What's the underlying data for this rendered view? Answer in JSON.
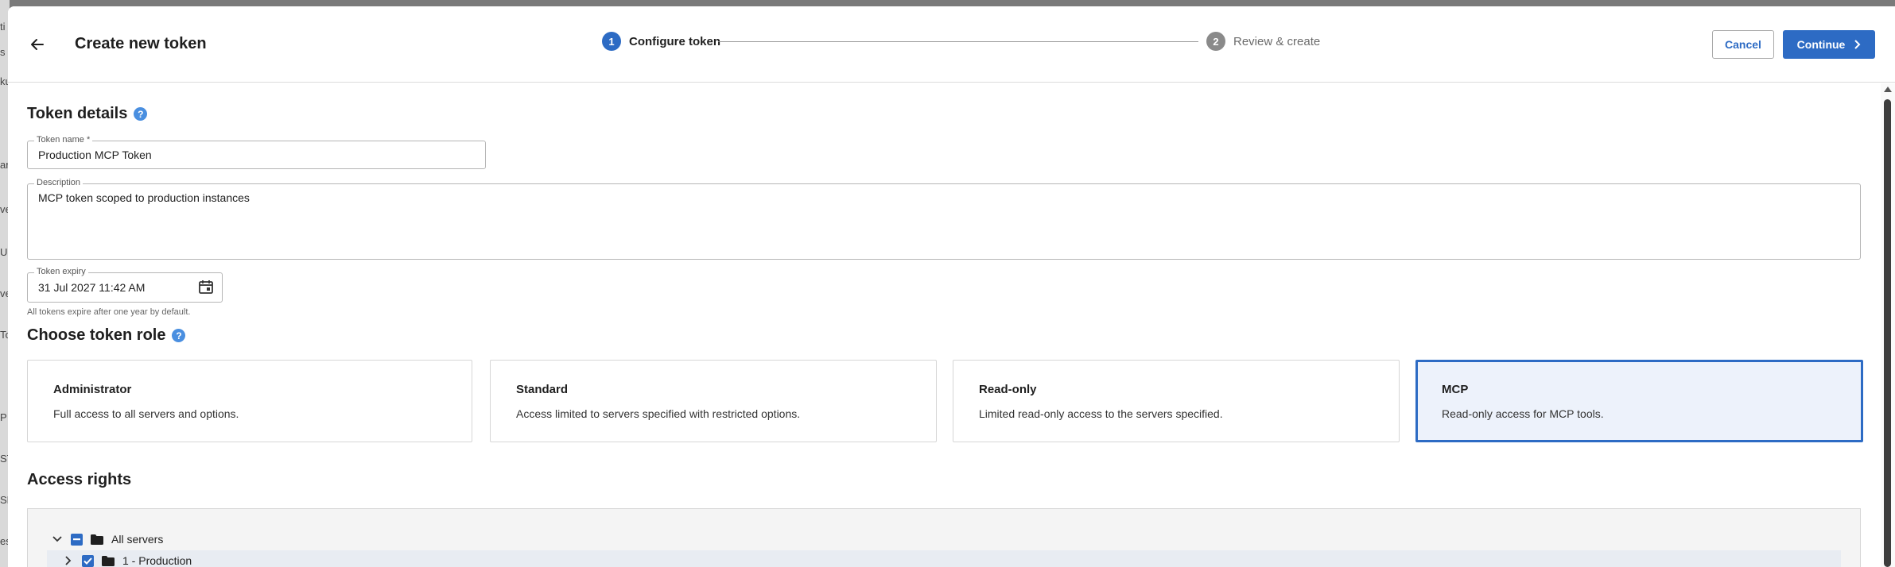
{
  "background": {
    "fragments": [
      "ti",
      "s",
      "ku",
      "ar",
      "ve",
      "UC",
      "ve",
      "To",
      "P",
      "ST",
      "SP",
      "es"
    ]
  },
  "header": {
    "title": "Create new token",
    "back_icon": "arrow-left-icon",
    "steps": [
      {
        "number": "1",
        "label": "Configure token",
        "state": "active"
      },
      {
        "number": "2",
        "label": "Review & create",
        "state": "inactive"
      }
    ],
    "cancel_label": "Cancel",
    "continue_label": "Continue"
  },
  "token_details": {
    "title": "Token details",
    "name_label": "Token name *",
    "name_value": "Production MCP Token",
    "description_label": "Description",
    "description_value": "MCP token scoped to production instances",
    "expiry_label": "Token expiry",
    "expiry_value": "31 Jul 2027 11:42 AM",
    "expiry_hint": "All tokens expire after one year by default."
  },
  "roles": {
    "title": "Choose token role",
    "selected": "MCP",
    "items": [
      {
        "name": "Administrator",
        "description": "Full access to all servers and options."
      },
      {
        "name": "Standard",
        "description": "Access limited to servers specified with restricted options."
      },
      {
        "name": "Read-only",
        "description": "Limited read-only access to the servers specified."
      },
      {
        "name": "MCP",
        "description": "Read-only access for MCP tools."
      }
    ]
  },
  "access_rights": {
    "title": "Access rights",
    "tree": [
      {
        "label": "All servers",
        "expanded": true,
        "checkbox": "indeterminate"
      },
      {
        "label": "1 - Production",
        "expanded": false,
        "checkbox": "checked"
      }
    ]
  },
  "colors": {
    "accent": "#2d6bc4",
    "selected_card_bg": "#edf2fb",
    "help_icon": "#4a8fe0"
  }
}
